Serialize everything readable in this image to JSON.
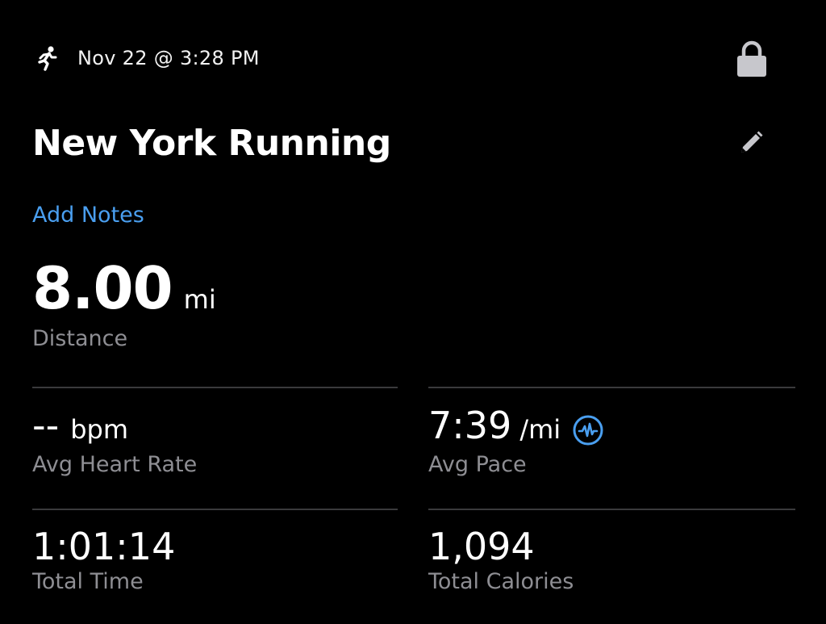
{
  "header": {
    "date": "Nov 22 @ 3:28 PM",
    "activity_icon": "running-figure-icon",
    "lock_icon": "lock-icon"
  },
  "workout": {
    "title": "New York Running",
    "edit_icon": "pencil-icon",
    "add_notes_label": "Add Notes"
  },
  "distance": {
    "value": "8.00",
    "unit": "mi",
    "label": "Distance"
  },
  "metrics": {
    "heart_rate": {
      "value": "--",
      "unit": "bpm",
      "label": "Avg Heart Rate"
    },
    "pace": {
      "value": "7:39",
      "unit": "/mi",
      "label": "Avg Pace",
      "icon": "activity-waveform-icon"
    },
    "total_time": {
      "value": "1:01:14",
      "label": "Total Time"
    },
    "calories": {
      "value": "1,094",
      "label": "Total Calories"
    }
  },
  "colors": {
    "background": "#000000",
    "accent_blue": "#4a9ff0",
    "secondary_text": "#8e8e93",
    "divider": "#3a3a3c",
    "icon_gray": "#c7c7cc"
  }
}
